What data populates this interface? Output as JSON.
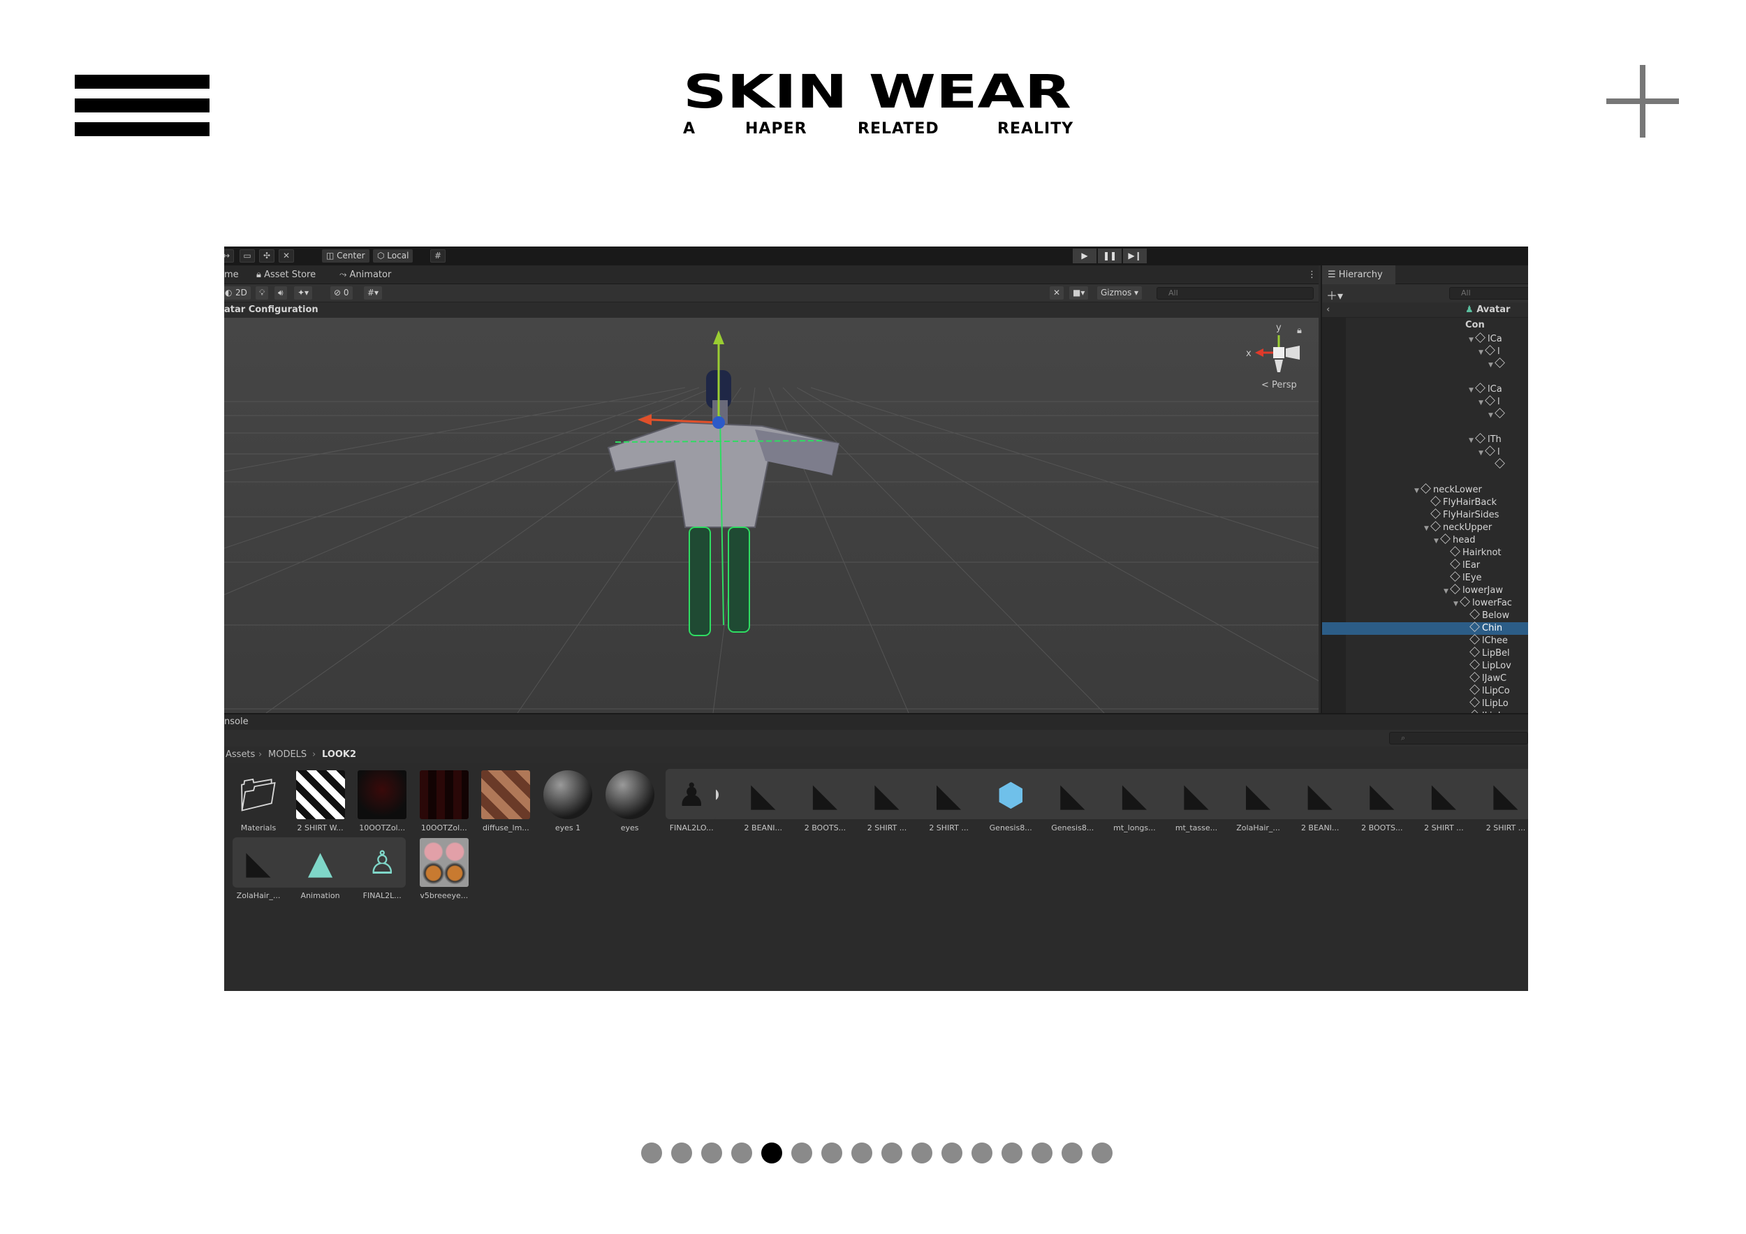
{
  "site": {
    "title": "SKIN WEAR",
    "tagline_words": [
      "A",
      "HAPER",
      "RELATED",
      "REALITY"
    ]
  },
  "pagination": {
    "count": 16,
    "active_index": 4
  },
  "editor": {
    "toolbar": {
      "pivot_label": "Center",
      "space_label": "Local"
    },
    "tabs": [
      "me",
      "Asset Store",
      "Animator"
    ],
    "scene_tools": {
      "mode_2d": "2D",
      "hidden_count": "0",
      "gizmos_label": "Gizmos",
      "search_placeholder": "All"
    },
    "scene_header": "atar Configuration",
    "view_label": "Persp",
    "axis_labels": {
      "x": "x",
      "y": "y"
    },
    "hierarchy": {
      "tab_label": "Hierarchy",
      "search_placeholder": "All",
      "root_label": "Avatar Con",
      "items": [
        {
          "label": "lCa",
          "depth": 3,
          "expanded": true
        },
        {
          "label": "l",
          "depth": 4,
          "expanded": true
        },
        {
          "label": "",
          "depth": 5,
          "expanded": true
        },
        {
          "label": "lCa",
          "depth": 3,
          "expanded": true
        },
        {
          "label": "l",
          "depth": 4,
          "expanded": true
        },
        {
          "label": "",
          "depth": 5,
          "expanded": true
        },
        {
          "label": "lTh",
          "depth": 3,
          "expanded": true
        },
        {
          "label": "l",
          "depth": 4,
          "expanded": true
        },
        {
          "label": "",
          "depth": 5,
          "expanded": false
        },
        {
          "label": "neckLower",
          "depth": 0,
          "expanded": true
        },
        {
          "label": "FlyHairBack",
          "depth": 1,
          "expanded": false
        },
        {
          "label": "FlyHairSides",
          "depth": 1,
          "expanded": false
        },
        {
          "label": "neckUpper",
          "depth": 1,
          "expanded": true
        },
        {
          "label": "head",
          "depth": 2,
          "expanded": true
        },
        {
          "label": "Hairknot",
          "depth": 3,
          "expanded": false
        },
        {
          "label": "lEar",
          "depth": 3,
          "expanded": false
        },
        {
          "label": "lEye",
          "depth": 3,
          "expanded": false
        },
        {
          "label": "lowerJaw",
          "depth": 3,
          "expanded": true
        },
        {
          "label": "lowerFac",
          "depth": 4,
          "expanded": true
        },
        {
          "label": "Below",
          "depth": 5,
          "expanded": false
        },
        {
          "label": "Chin",
          "depth": 5,
          "expanded": false,
          "selected": true
        },
        {
          "label": "lChee",
          "depth": 5,
          "expanded": false
        },
        {
          "label": "LipBel",
          "depth": 5,
          "expanded": false
        },
        {
          "label": "LipLov",
          "depth": 5,
          "expanded": false
        },
        {
          "label": "lJawC",
          "depth": 5,
          "expanded": false
        },
        {
          "label": "lLipCo",
          "depth": 5,
          "expanded": false
        },
        {
          "label": "lLipLo",
          "depth": 5,
          "expanded": false
        },
        {
          "label": "lLipI",
          "depth": 5,
          "expanded": false
        }
      ]
    },
    "console_label": "nsole",
    "breadcrumb": [
      "Assets",
      "MODELS",
      "LOOK2"
    ],
    "assets_row1": [
      {
        "label": "Materials",
        "kind": "folder-icon"
      },
      {
        "label": "2 SHIRT W...",
        "kind": "texture"
      },
      {
        "label": "10OOTZol...",
        "kind": "texture-dark"
      },
      {
        "label": "10OOTZol...",
        "kind": "texture-dark2"
      },
      {
        "label": "diffuse_lm...",
        "kind": "texture-skin"
      },
      {
        "label": "eyes 1",
        "kind": "sphere"
      },
      {
        "label": "eyes",
        "kind": "sphere"
      },
      {
        "label": "FINAL2LO...",
        "kind": "model"
      },
      {
        "label": "2 BEANI...",
        "kind": "mesh"
      },
      {
        "label": "2 BOOTS...",
        "kind": "mesh"
      },
      {
        "label": "2 SHIRT ...",
        "kind": "mesh"
      },
      {
        "label": "2 SHIRT ...",
        "kind": "mesh"
      },
      {
        "label": "Genesis8...",
        "kind": "prefab"
      },
      {
        "label": "Genesis8...",
        "kind": "mesh"
      },
      {
        "label": "mt_longs...",
        "kind": "mesh"
      },
      {
        "label": "mt_tasse...",
        "kind": "mesh"
      },
      {
        "label": "ZolaHair_...",
        "kind": "mesh"
      },
      {
        "label": "2 BEANI...",
        "kind": "mesh"
      },
      {
        "label": "2 BOOTS...",
        "kind": "mesh"
      },
      {
        "label": "2 SHIRT ...",
        "kind": "mesh"
      },
      {
        "label": "2 SHIRT ...",
        "kind": "mesh"
      }
    ],
    "assets_row2": [
      {
        "label": "ZolaHair_...",
        "kind": "mesh"
      },
      {
        "label": "Animation",
        "kind": "animation"
      },
      {
        "label": "FINAL2L...",
        "kind": "avatar"
      },
      {
        "label": "v5breeeye...",
        "kind": "texture-eyes"
      }
    ]
  }
}
